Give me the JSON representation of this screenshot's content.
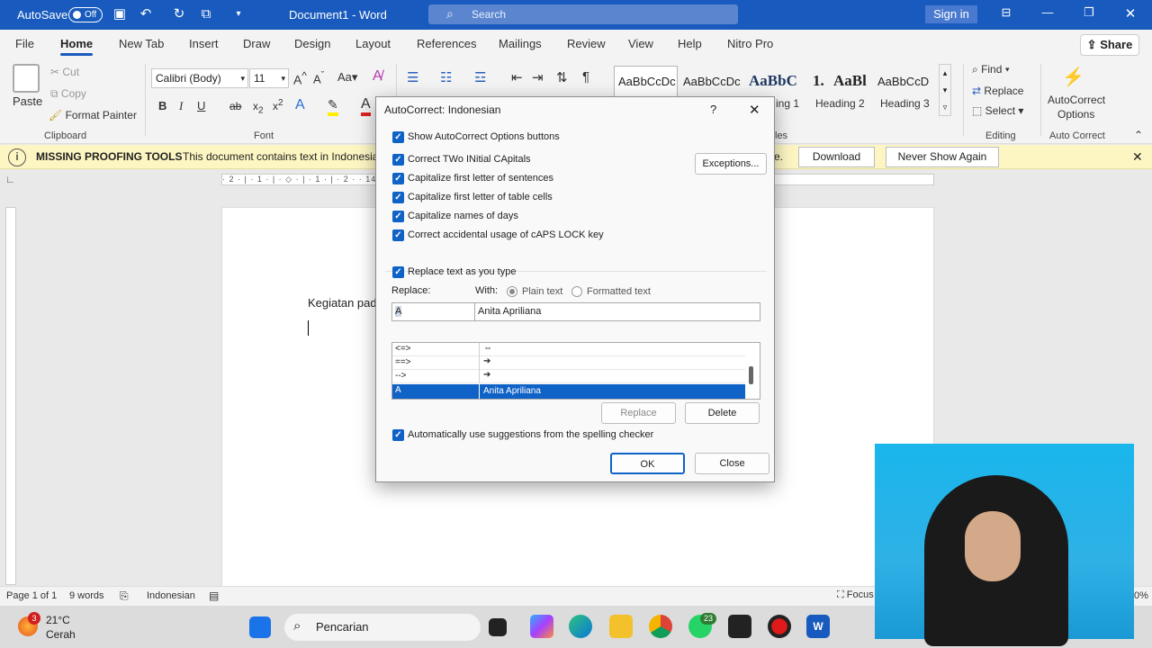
{
  "titlebar": {
    "autosave": "AutoSave",
    "toggle": "Off",
    "doc_title": "Document1 - Word",
    "search": "Search",
    "signin": "Sign in"
  },
  "tabs": [
    "File",
    "Home",
    "New Tab",
    "Insert",
    "Draw",
    "Design",
    "Layout",
    "References",
    "Mailings",
    "Review",
    "View",
    "Help",
    "Nitro Pro"
  ],
  "share": "Share",
  "ribbon": {
    "paste": "Paste",
    "cut": "Cut",
    "copy": "Copy",
    "format_painter": "Format Painter",
    "clipboard": "Clipboard",
    "font_name": "Calibri (Body)",
    "font_size": "11",
    "font": "Font",
    "style_normal": "AaBbCcDc",
    "style_nospacing": "AaBbCcDc",
    "style_h1_sample": "AaBbC",
    "style_list": "1.",
    "style_h2_sample": "AaBl",
    "style_h3_sample": "AaBbCcD",
    "h1": "ing 1",
    "h2": "Heading 2",
    "h3": "Heading 3",
    "styles": "les",
    "find": "Find",
    "replace": "Replace",
    "select": "Select",
    "editing": "Editing",
    "autocorrect": "AutoCorrect",
    "autocorrect2": "Options",
    "autocorrect_group": "Auto Correct"
  },
  "infobar": {
    "title": "MISSING PROOFING TOOLS",
    "text": "This document contains text in Indonesia",
    "tail": "e.",
    "download": "Download",
    "never": "Never Show Again"
  },
  "ruler": "· 2 · | · 1 · | · ◇ · | · 1 · | · 2 ·                                                                         · 14 · | · 15 · | · 16 · | · 17 · | · 18 ·",
  "document": {
    "text": "Kegiatan pad"
  },
  "status": {
    "page": "Page 1 of 1",
    "words": "9 words",
    "lang": "Indonesian",
    "focus": "Focus",
    "zoom": "0%"
  },
  "taskbar": {
    "badge": "3",
    "temp": "21°C",
    "weather": "Cerah",
    "search": "Pencarian",
    "wa_badge": "23"
  },
  "dialog": {
    "title": "AutoCorrect: Indonesian",
    "help": "?",
    "options": [
      "Show AutoCorrect Options buttons",
      "Correct TWo INitial CApitals",
      "Capitalize first letter of sentences",
      "Capitalize first letter of table cells",
      "Capitalize names of days",
      "Correct accidental usage of cAPS LOCK key"
    ],
    "exceptions": "Exceptions...",
    "replace_as_type": "Replace text as you type",
    "replace_label": "Replace:",
    "with_label": "With:",
    "plain": "Plain text",
    "formatted": "Formatted text",
    "replace_value": "A",
    "with_value": "Anita Apriliana",
    "entries": [
      [
        "<=>",
        "⇔"
      ],
      [
        "==>",
        "➔"
      ],
      [
        "-->",
        "➔"
      ],
      [
        "A",
        "Anita Apriliana"
      ]
    ],
    "btn_replace": "Replace",
    "btn_delete": "Delete",
    "auto_suggest": "Automatically use suggestions from the spelling checker",
    "ok": "OK",
    "close": "Close"
  },
  "colors": {
    "brand": "#185abd",
    "accent": "#0f62c6",
    "infobar": "#fdf6c3"
  }
}
